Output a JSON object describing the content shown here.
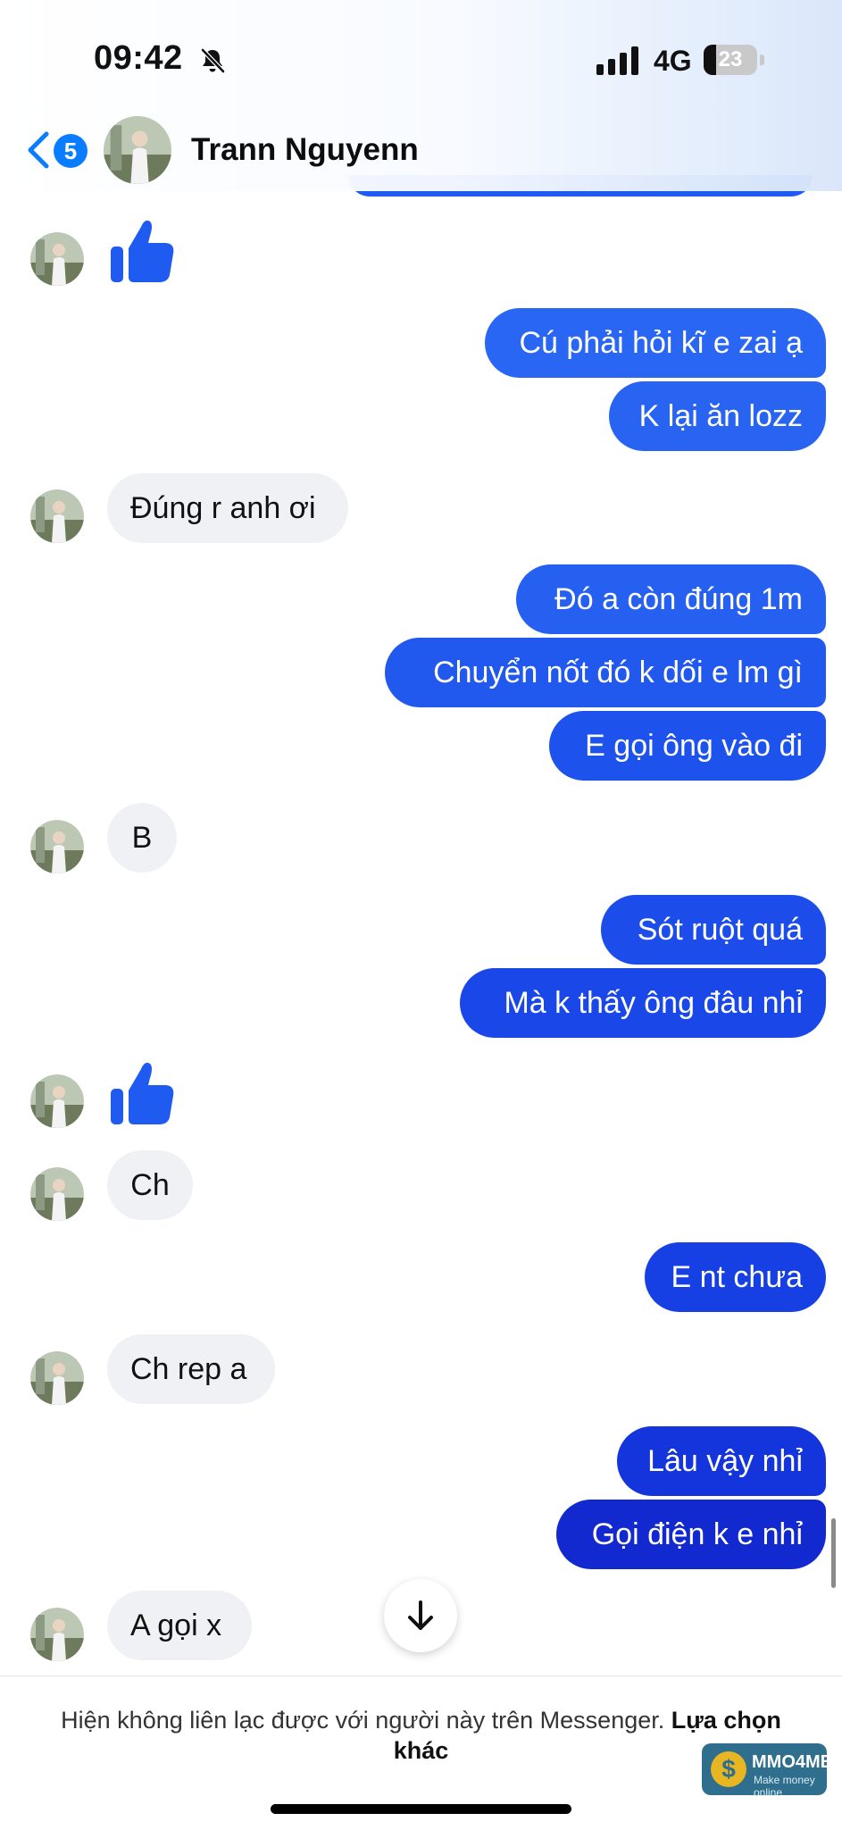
{
  "status_bar": {
    "time": "09:42",
    "network": "4G",
    "battery": "23",
    "icons": [
      "muted-bell-icon",
      "signal-icon",
      "battery-icon"
    ]
  },
  "header": {
    "back_badge": "5",
    "contact_name": "Trann Nguyenn",
    "icons": [
      "back-chevron-icon",
      "avatar"
    ]
  },
  "messages": [
    {
      "from": "them",
      "kind": "like"
    },
    {
      "from": "me",
      "text": "Cú phải hỏi kĩ e zai ạ"
    },
    {
      "from": "me",
      "text": "K lại ăn lozz"
    },
    {
      "from": "them",
      "text": "Đúng r anh ơi"
    },
    {
      "from": "me",
      "text": "Đó a còn đúng 1m"
    },
    {
      "from": "me",
      "text": "Chuyển nốt đó k dối e lm gì"
    },
    {
      "from": "me",
      "text": "E gọi ông vào đi"
    },
    {
      "from": "them",
      "text": "B"
    },
    {
      "from": "me",
      "text": "Sót ruột quá"
    },
    {
      "from": "me",
      "text": "Mà k thấy ông đâu nhỉ"
    },
    {
      "from": "them",
      "kind": "like"
    },
    {
      "from": "them",
      "text": "Ch"
    },
    {
      "from": "me",
      "text": "E nt chưa"
    },
    {
      "from": "them",
      "text": "Ch rep a"
    },
    {
      "from": "me",
      "text": "Lâu vậy nhỉ"
    },
    {
      "from": "me",
      "text": "Gọi điện k e nhỉ"
    },
    {
      "from": "them",
      "text": "A gọi x"
    }
  ],
  "footer": {
    "notice": "Hiện không liên lạc được với người này trên Messenger.",
    "link": "Lựa chọn khác"
  },
  "watermark": {
    "symbol": "$",
    "brand": "MMO4ME",
    "tagline": "Make money online"
  },
  "colors": {
    "bubble_out_top": "#2b68f5",
    "bubble_out_bottom": "#1026c5",
    "bubble_in": "#eff1f5",
    "like": "#1f5bf1",
    "badge": "#0a7cff"
  }
}
